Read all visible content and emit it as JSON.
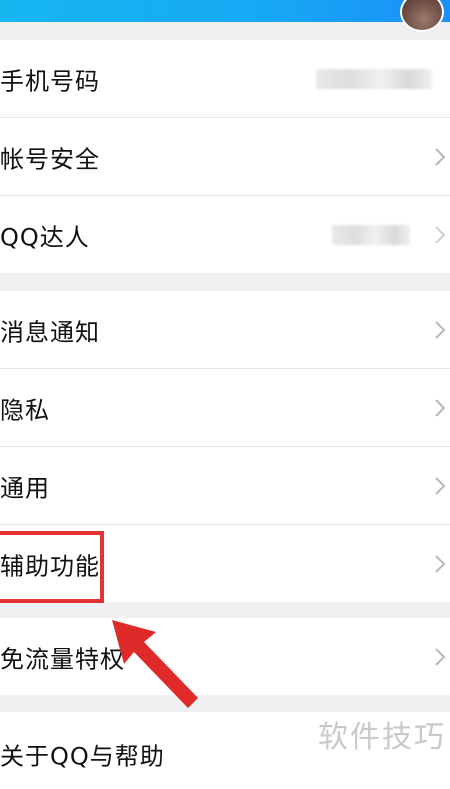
{
  "settings": {
    "items": [
      {
        "label": "手机号码"
      },
      {
        "label": "帐号安全"
      },
      {
        "label": "QQ达人"
      },
      {
        "label": "消息通知"
      },
      {
        "label": "隐私"
      },
      {
        "label": "通用"
      },
      {
        "label": "辅助功能"
      },
      {
        "label": "免流量特权"
      },
      {
        "label": "关于QQ与帮助"
      }
    ]
  },
  "icons": {
    "chevron": "chevron-right-icon",
    "avatar": "avatar",
    "arrow": "red-arrow"
  },
  "colors": {
    "accent": "#16b6ef",
    "highlight": "#e23232"
  },
  "watermark": {
    "text": "软件技巧"
  }
}
